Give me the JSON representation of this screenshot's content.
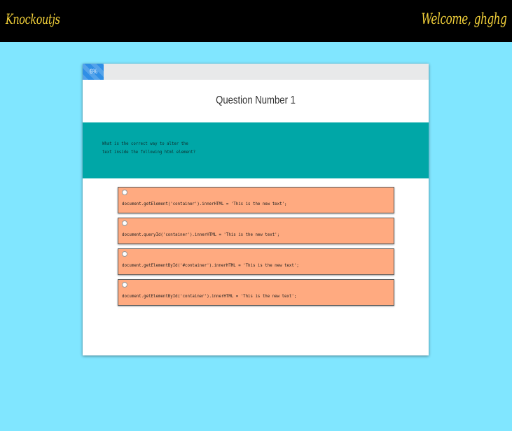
{
  "header": {
    "brand": "Knockoutjs",
    "welcome": "Welcome, ghghg"
  },
  "progress": {
    "label": "6%",
    "value": 6
  },
  "question": {
    "title": "Question Number 1",
    "text": "What is the correct way to alter the text inside the following html element?"
  },
  "options": [
    {
      "text": "document.getElement('container').innerHTML = 'This is the new text';"
    },
    {
      "text": "document.queryId('container').innerHTML = 'This is the new text';"
    },
    {
      "text": "document.getElementById('#container').innerHTML = 'This is the new text';"
    },
    {
      "text": "document.getElementById('container').innerHTML = 'This is the new text';"
    }
  ],
  "colors": {
    "header_bg": "#000000",
    "brand_text": "#f4d23a",
    "page_bg": "#80e6ff",
    "progress_fill": "#2f8fe6",
    "question_panel": "#00a7a7",
    "option_bg": "#ffaa80"
  }
}
